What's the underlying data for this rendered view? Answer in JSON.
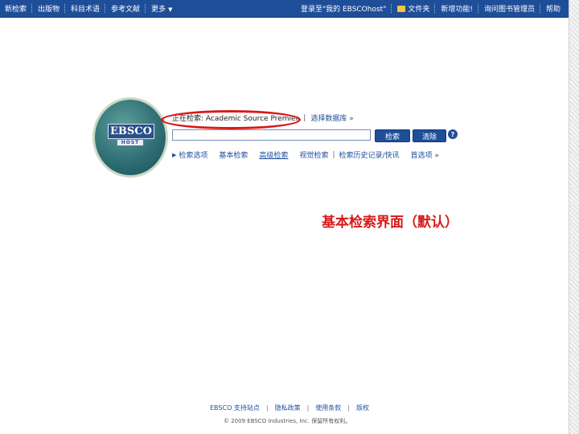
{
  "topbar": {
    "left": [
      {
        "label": "新检索"
      },
      {
        "label": "出版物"
      },
      {
        "label": "科目术语"
      },
      {
        "label": "参考文献"
      },
      {
        "label": "更多"
      }
    ],
    "right": [
      {
        "label": "登录至\"我的 EBSCOhost\""
      },
      {
        "label": "文件夹"
      },
      {
        "label": "新增功能!"
      },
      {
        "label": "询问图书管理员"
      },
      {
        "label": "帮助"
      }
    ]
  },
  "logo": {
    "text": "EBSCO",
    "sub": "HOST"
  },
  "search": {
    "database_label": "正在检索: Academic Source Premier",
    "choose_db": "选择数据库 »",
    "input_value": "",
    "search_button": "检索",
    "clear_button": "清除",
    "help_symbol": "?"
  },
  "links": {
    "search_options": "检索选项",
    "basic": "基本检索",
    "advanced": "高级检索",
    "visual": "视觉检索",
    "history": "检索历史记录/快讯",
    "preferences": "首选项 »"
  },
  "caption": "基本检索界面（默认）",
  "footer": {
    "links": [
      "EBSCO 支持站点",
      "隐私政策",
      "使用条款",
      "版权"
    ],
    "copyright": "© 2009 EBSCO Industries, Inc. 保留所有权利。"
  },
  "colors": {
    "topbar": "#1f4e99",
    "accent_red": "#d71818"
  }
}
